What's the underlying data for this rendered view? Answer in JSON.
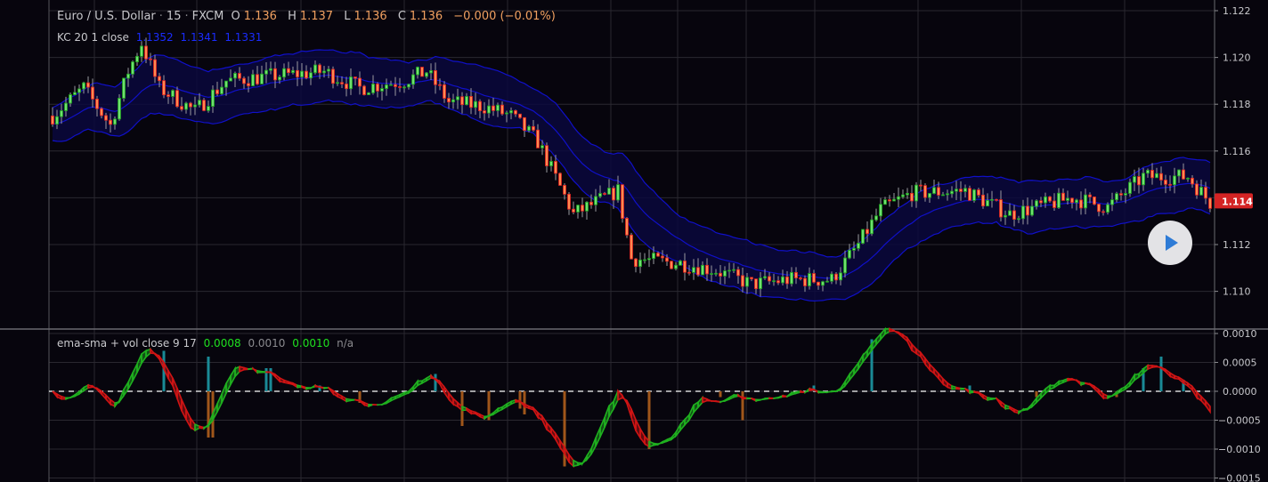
{
  "header": {
    "symbol": "Euro / U.S. Dollar",
    "sep1": "·",
    "interval": "15",
    "sep2": "·",
    "exchange": "FXCM",
    "o_label": "O",
    "o": "1.136",
    "h_label": "H",
    "h": "1.137",
    "l_label": "L",
    "l": "1.136",
    "c_label": "C",
    "c": "1.136",
    "change": "−0.000 (−0.01%)"
  },
  "kc_legend": {
    "label": "KC 20 1 close",
    "upper": "1.1352",
    "middle": "1.1341",
    "lower": "1.1331"
  },
  "osc_legend": {
    "label": "ema-sma + vol close 9 17",
    "v1": "0.0008",
    "v2": "0.0010",
    "v3": "0.0010",
    "v4": "n/a"
  },
  "colors": {
    "up": "#6fe06f",
    "up_border": "#1fa01f",
    "down": "#ff8a50",
    "down_border": "#e02020",
    "kc": "#1010c8",
    "kc_fill": "#0a0840",
    "grid": "#2a2830",
    "last_price_bg": "#d42424",
    "vol_up": "#1a8a96",
    "vol_down": "#a0561a",
    "osc_up": "#1fb01f",
    "osc_down": "#d01414"
  },
  "chart_data": [
    {
      "type": "candlestick",
      "title": "Euro / U.S. Dollar · 15 · FXCM",
      "ylim": [
        1.1086,
        1.1224
      ],
      "yticks": [
        "1.122",
        "1.120",
        "1.118",
        "1.116",
        "1.114",
        "1.112",
        "1.110"
      ],
      "last_price": "1.114",
      "bars": 261,
      "close_path_keypoints": [
        [
          0,
          1.1175
        ],
        [
          7,
          1.1187
        ],
        [
          13,
          1.1171
        ],
        [
          17,
          1.1194
        ],
        [
          20,
          1.1206
        ],
        [
          24,
          1.1187
        ],
        [
          32,
          1.1177
        ],
        [
          39,
          1.119
        ],
        [
          49,
          1.1192
        ],
        [
          61,
          1.1194
        ],
        [
          69,
          1.1187
        ],
        [
          79,
          1.119
        ],
        [
          84,
          1.1194
        ],
        [
          89,
          1.1181
        ],
        [
          97,
          1.1179
        ],
        [
          103,
          1.1175
        ],
        [
          109,
          1.1164
        ],
        [
          117,
          1.1133
        ],
        [
          127,
          1.1143
        ],
        [
          130,
          1.1114
        ],
        [
          141,
          1.1112
        ],
        [
          149,
          1.1109
        ],
        [
          157,
          1.1103
        ],
        [
          165,
          1.1105
        ],
        [
          175,
          1.1105
        ],
        [
          181,
          1.112
        ],
        [
          186,
          1.1135
        ],
        [
          193,
          1.1142
        ],
        [
          205,
          1.1143
        ],
        [
          215,
          1.1133
        ],
        [
          229,
          1.114
        ],
        [
          237,
          1.1136
        ],
        [
          245,
          1.1149
        ],
        [
          255,
          1.1149
        ],
        [
          260,
          1.1138
        ]
      ],
      "overlay": "Keltner Channel 20 1 close"
    },
    {
      "type": "line",
      "title": "ema-sma + vol close 9 17",
      "ylim": [
        -0.0016,
        0.00105
      ],
      "yticks": [
        "0.0010",
        "0.0005",
        "0.0000",
        "−0.0005",
        "−0.0010",
        "−0.0015"
      ],
      "vol_bars": [
        [
          25,
          0.0007
        ],
        [
          35,
          0.0006
        ],
        [
          48,
          0.0004
        ],
        [
          49,
          0.0004
        ],
        [
          60,
          0.0001
        ],
        [
          86,
          0.0003
        ],
        [
          171,
          0.0001
        ],
        [
          184,
          0.0009
        ],
        [
          206,
          0.0001
        ],
        [
          245,
          0.0004
        ],
        [
          249,
          0.0006
        ],
        [
          254,
          0.0002
        ],
        [
          35,
          -0.0008
        ],
        [
          36,
          -0.0008
        ],
        [
          69,
          -0.0002
        ],
        [
          92,
          -0.0006
        ],
        [
          98,
          -0.0005
        ],
        [
          105,
          -0.0003
        ],
        [
          106,
          -0.0004
        ],
        [
          115,
          -0.0013
        ],
        [
          134,
          -0.001
        ],
        [
          150,
          -0.0001
        ],
        [
          155,
          -0.0005
        ],
        [
          221,
          -0.0001
        ],
        [
          239,
          -0.0001
        ]
      ]
    }
  ]
}
